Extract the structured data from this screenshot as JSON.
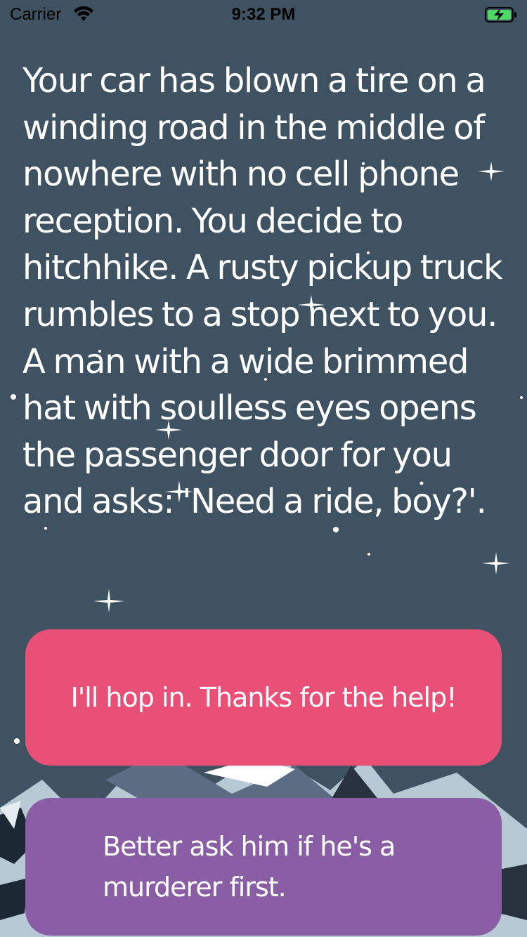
{
  "status_bar": {
    "carrier": "Carrier",
    "time": "9:32 PM",
    "wifi_icon": "wifi-icon",
    "battery_icon": "battery-charging-icon"
  },
  "story": {
    "text": "Your car has blown a tire on a winding road in the middle of nowhere with no cell phone reception. You decide to hitchhike. A rusty pickup truck rumbles to a stop next to you. A man with a wide brimmed hat with soulless eyes opens the passenger door for you and asks: 'Need a ride, boy?'."
  },
  "choices": [
    {
      "label": "I'll hop in. Thanks for the help!"
    },
    {
      "label": "Better ask him if he's a murderer first."
    }
  ],
  "colors": {
    "background": "#3f5261",
    "choice_1": "#e85078",
    "choice_2": "#8a5ea4",
    "text": "#ffffff"
  }
}
